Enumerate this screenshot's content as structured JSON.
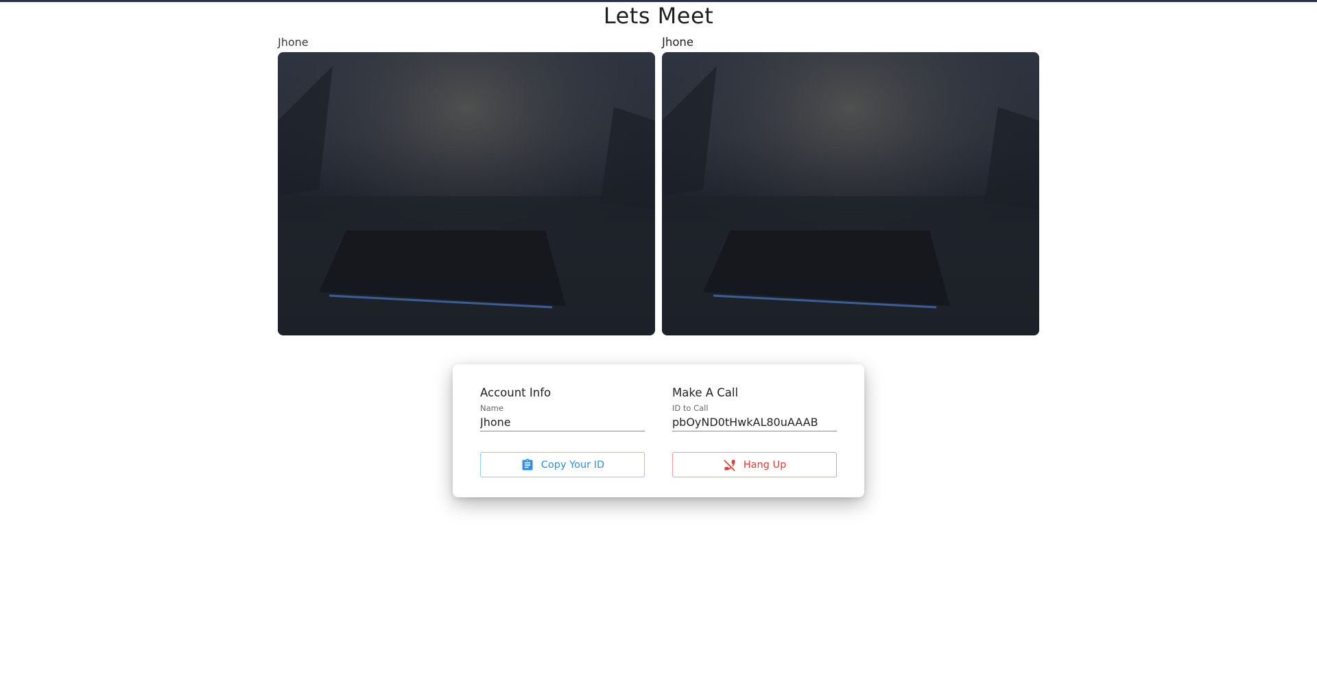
{
  "title": "Lets Meet",
  "videos": {
    "local": {
      "label": "Jhone"
    },
    "remote": {
      "label": "Jhone"
    }
  },
  "account": {
    "heading": "Account Info",
    "name_label": "Name",
    "name_value": "Jhone",
    "copy_button": "Copy Your ID",
    "copy_icon": "clipboard-icon"
  },
  "call": {
    "heading": "Make A Call",
    "id_label": "ID to Call",
    "id_value": "pbOyND0tHwkAL80uAAAB",
    "hangup_button": "Hang Up",
    "hangup_icon": "phone-disabled-icon"
  },
  "colors": {
    "primary": "#2f8ee6",
    "danger": "#e53935",
    "top_bar": "#2b3140"
  }
}
